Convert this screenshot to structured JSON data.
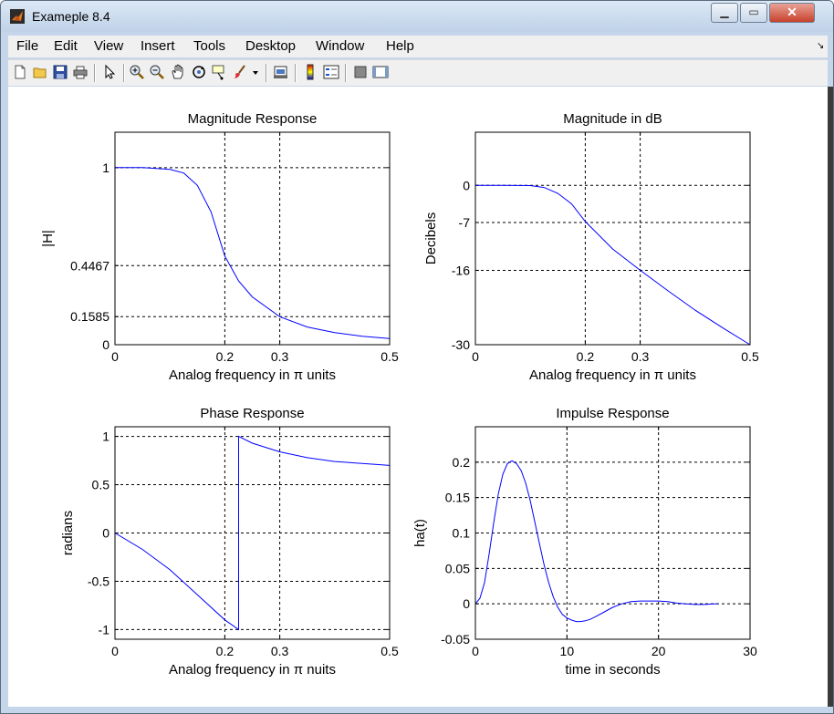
{
  "window": {
    "title": "Exameple 8.4",
    "menus": [
      "File",
      "Edit",
      "View",
      "Insert",
      "Tools",
      "Desktop",
      "Window",
      "Help"
    ],
    "toolbar_icons": [
      "new-figure-icon",
      "open-file-icon",
      "save-icon",
      "print-icon",
      "edit-plot-arrow-icon",
      "zoom-in-icon",
      "zoom-out-icon",
      "pan-hand-icon",
      "rotate-3d-icon",
      "data-cursor-icon",
      "brush-icon",
      "brush-dropdown-icon",
      "link-plot-icon",
      "colorbar-icon",
      "legend-icon",
      "hide-plot-tools-icon",
      "show-plot-tools-icon"
    ]
  },
  "chart_data": [
    {
      "type": "line",
      "title": "Magnitude Response",
      "xlabel": "Analog frequency in π units",
      "ylabel": "|H|",
      "xlim": [
        0,
        0.5
      ],
      "ylim": [
        0,
        1.2
      ],
      "xticks": [
        0,
        0.2,
        0.3,
        0.5
      ],
      "xtick_labels": [
        "0",
        "0.2",
        "0.3",
        "0.5"
      ],
      "yticks": [
        0,
        0.1585,
        0.4467,
        1
      ],
      "ytick_labels": [
        "0",
        "0.1585",
        "0.4467",
        "1"
      ],
      "grid": true,
      "color": "#0000ff",
      "x": [
        0,
        0.05,
        0.1,
        0.125,
        0.15,
        0.175,
        0.2,
        0.225,
        0.25,
        0.3,
        0.35,
        0.4,
        0.45,
        0.5
      ],
      "y": [
        1,
        1,
        0.99,
        0.97,
        0.9,
        0.75,
        0.5,
        0.36,
        0.27,
        0.158,
        0.1,
        0.068,
        0.048,
        0.035
      ]
    },
    {
      "type": "line",
      "title": "Magnitude in dB",
      "xlabel": "Analog frequency in π units",
      "ylabel": "Decibels",
      "xlim": [
        0,
        0.5
      ],
      "ylim": [
        -30,
        10
      ],
      "xticks": [
        0,
        0.2,
        0.3,
        0.5
      ],
      "xtick_labels": [
        "0",
        "0.2",
        "0.3",
        "0.5"
      ],
      "yticks": [
        -30,
        -16,
        -7,
        0
      ],
      "ytick_labels": [
        "-30",
        "-16",
        "-7",
        "0"
      ],
      "grid": true,
      "color": "#0000ff",
      "x": [
        0,
        0.05,
        0.1,
        0.125,
        0.15,
        0.175,
        0.2,
        0.25,
        0.3,
        0.35,
        0.4,
        0.45,
        0.5
      ],
      "y": [
        0,
        0,
        -0.05,
        -0.4,
        -1.5,
        -3.5,
        -6.8,
        -12,
        -16,
        -19.8,
        -23.5,
        -26.8,
        -30
      ]
    },
    {
      "type": "line",
      "title": "Phase Response",
      "xlabel": "Analog frequency in π nuits",
      "ylabel": "radians",
      "xlim": [
        0,
        0.5
      ],
      "ylim": [
        -1.1,
        1.1
      ],
      "xticks": [
        0,
        0.2,
        0.3,
        0.5
      ],
      "xtick_labels": [
        "0",
        "0.2",
        "0.3",
        "0.5"
      ],
      "yticks": [
        -1,
        -0.5,
        0,
        0.5,
        1
      ],
      "ytick_labels": [
        "-1",
        "-0.5",
        "0",
        "0.5",
        "1"
      ],
      "grid": true,
      "color": "#0000ff",
      "x": [
        0,
        0.05,
        0.1,
        0.15,
        0.2,
        0.225,
        0.225,
        0.25,
        0.3,
        0.35,
        0.4,
        0.45,
        0.5
      ],
      "y": [
        0,
        -0.17,
        -0.38,
        -0.64,
        -0.9,
        -1,
        1,
        0.93,
        0.84,
        0.78,
        0.74,
        0.72,
        0.7
      ]
    },
    {
      "type": "line",
      "title": "Impulse Response",
      "xlabel": "time in seconds",
      "ylabel": "ha(t)",
      "xlim": [
        0,
        30
      ],
      "ylim": [
        -0.05,
        0.25
      ],
      "xticks": [
        0,
        10,
        20,
        30
      ],
      "xtick_labels": [
        "0",
        "10",
        "20",
        "30"
      ],
      "yticks": [
        -0.05,
        0,
        0.05,
        0.1,
        0.15,
        0.2
      ],
      "ytick_labels": [
        "-0.05",
        "0",
        "0.05",
        "0.1",
        "0.15",
        "0.2"
      ],
      "grid": true,
      "color": "#0000ff",
      "x": [
        0,
        0.5,
        1,
        1.5,
        2,
        2.5,
        3,
        3.5,
        4,
        4.5,
        5,
        5.5,
        6,
        6.5,
        7,
        7.5,
        8,
        8.5,
        9,
        9.5,
        10,
        10.5,
        11,
        11.5,
        12,
        12.5,
        13,
        14,
        15,
        16,
        17,
        18,
        19,
        20,
        21,
        22,
        23,
        24,
        25,
        26,
        26.5
      ],
      "y": [
        0,
        0.008,
        0.03,
        0.07,
        0.115,
        0.155,
        0.183,
        0.198,
        0.202,
        0.198,
        0.188,
        0.17,
        0.145,
        0.115,
        0.085,
        0.055,
        0.03,
        0.01,
        -0.005,
        -0.015,
        -0.02,
        -0.023,
        -0.025,
        -0.025,
        -0.024,
        -0.022,
        -0.019,
        -0.012,
        -0.005,
        0,
        0.003,
        0.004,
        0.004,
        0.004,
        0.003,
        0.001,
        0,
        -0.001,
        -0.001,
        0,
        0
      ]
    }
  ]
}
